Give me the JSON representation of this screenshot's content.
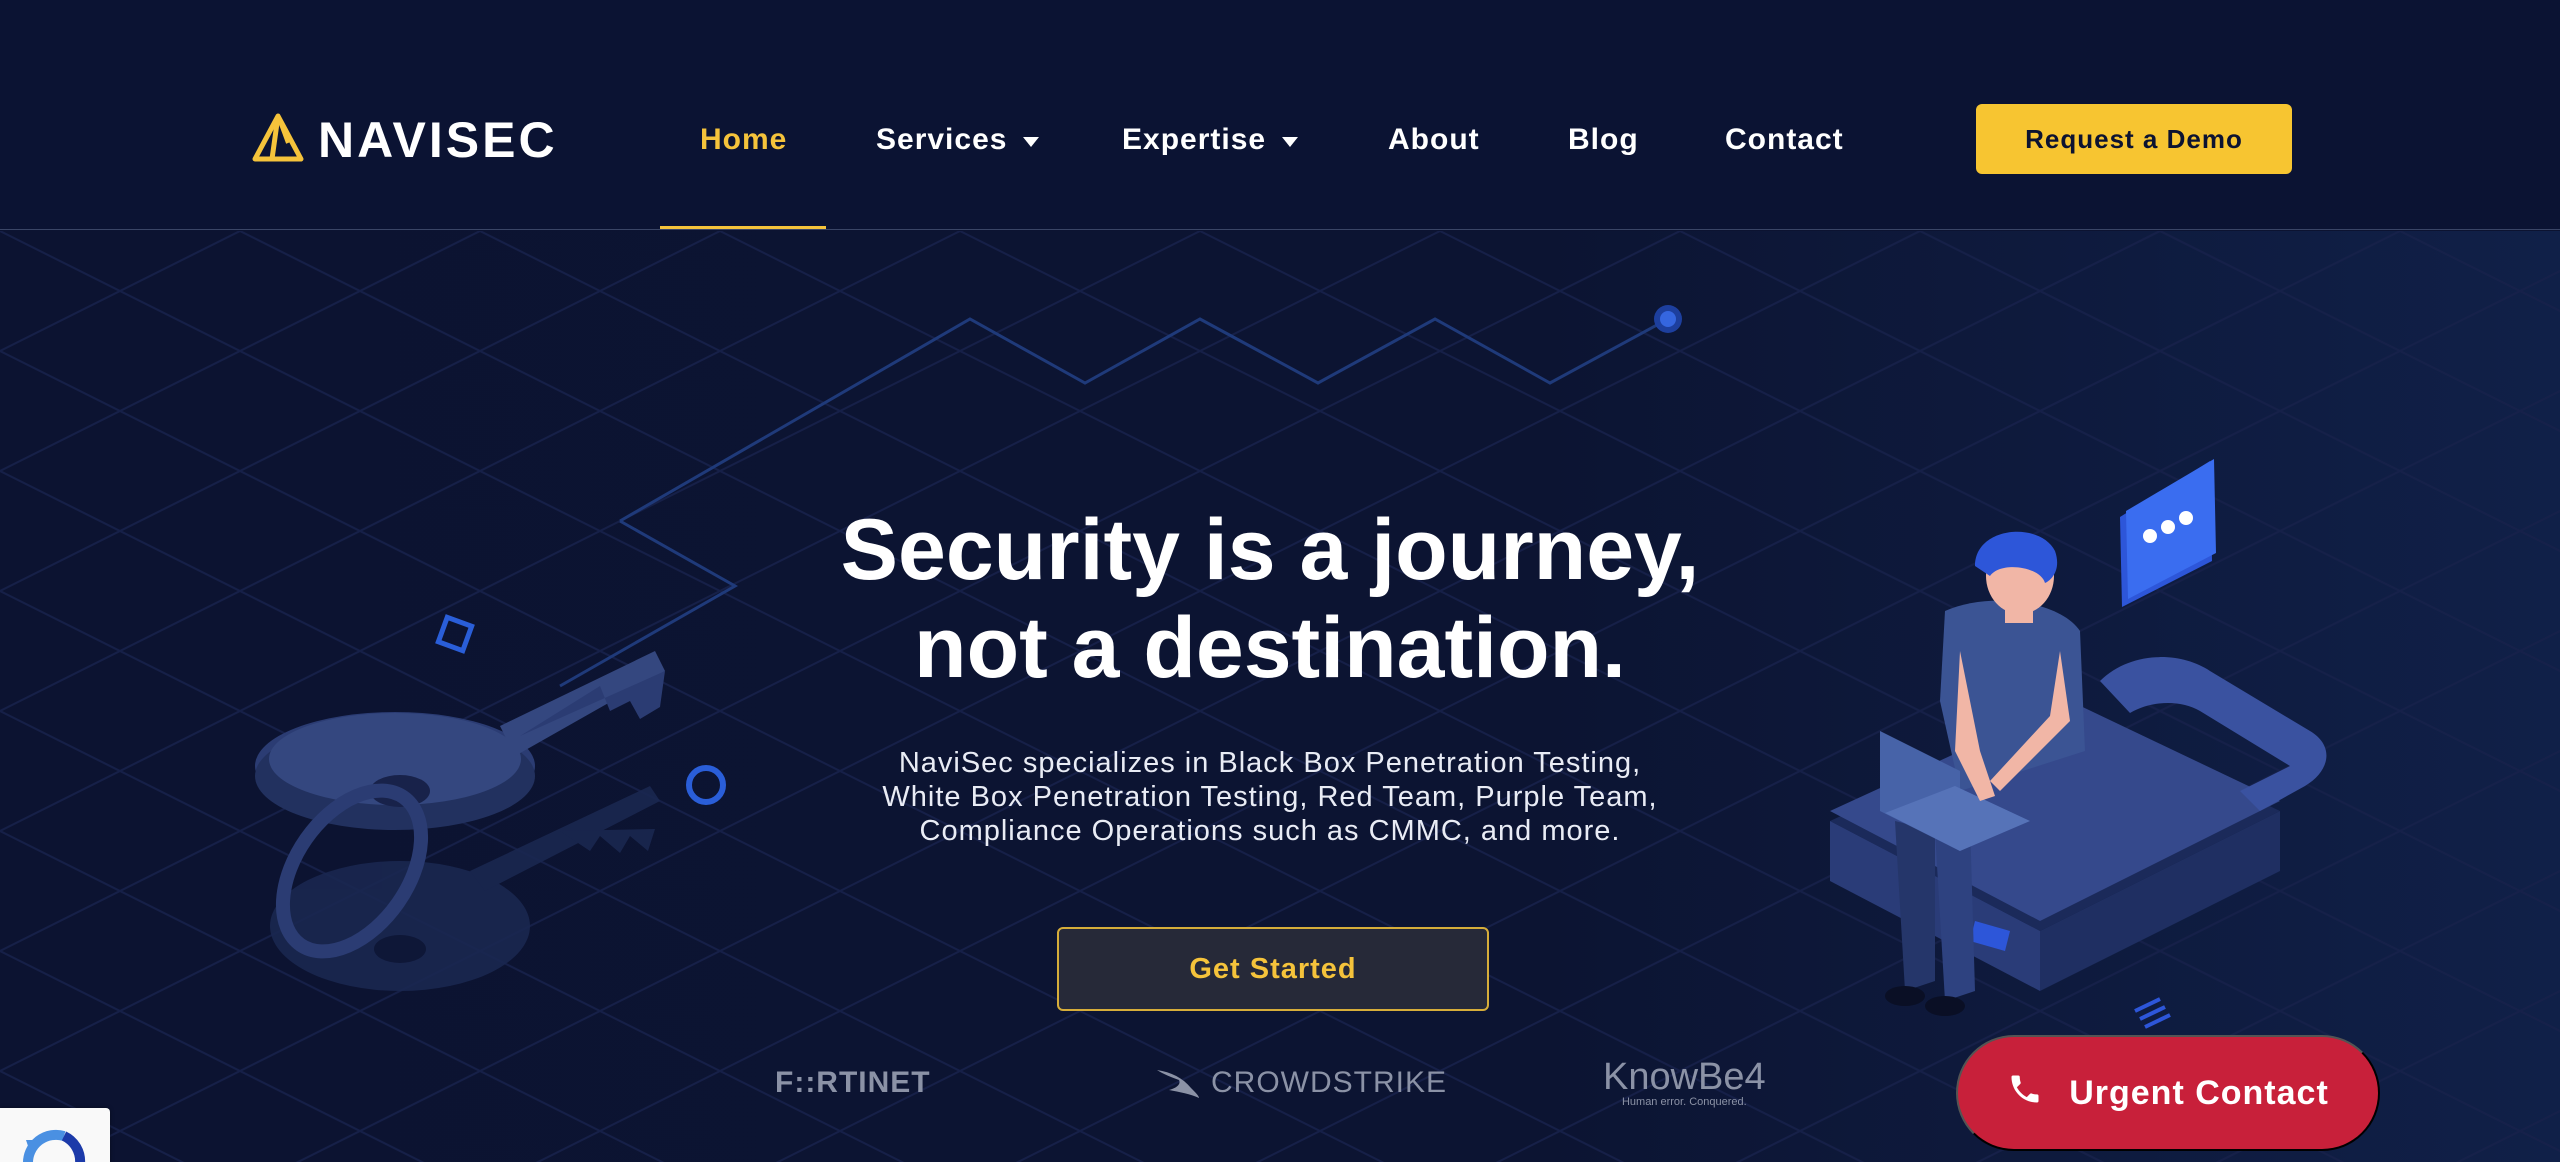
{
  "brand": {
    "name": "NAVISEC",
    "accent": "#f5c33b",
    "background": "#0c1331"
  },
  "nav": {
    "items": [
      {
        "label": "Home",
        "active": true
      },
      {
        "label": "Services",
        "dropdown": true
      },
      {
        "label": "Expertise",
        "dropdown": true
      },
      {
        "label": "About"
      },
      {
        "label": "Blog"
      },
      {
        "label": "Contact"
      }
    ],
    "demo_label": "Request a Demo"
  },
  "hero": {
    "headline_line1": "Security is a journey,",
    "headline_line2": "not a destination.",
    "sub_line1": "NaviSec specializes in Black Box Penetration Testing,",
    "sub_line2": "White Box Penetration Testing, Red Team, Purple Team,",
    "sub_line3": "Compliance Operations such as CMMC, and more.",
    "cta_label": "Get Started"
  },
  "partners": {
    "fortinet": "F::RTINET",
    "crowdstrike": "CROWDSTRIKE",
    "knowbe4": "KnowBe4",
    "knowbe4_tagline": "Human error. Conquered."
  },
  "urgent": {
    "label": "Urgent Contact",
    "color": "#c8203a",
    "icon": "phone-icon"
  },
  "icons": [
    "logo-triangle-icon",
    "chevron-down-icon",
    "phone-icon",
    "recaptcha-icon"
  ]
}
